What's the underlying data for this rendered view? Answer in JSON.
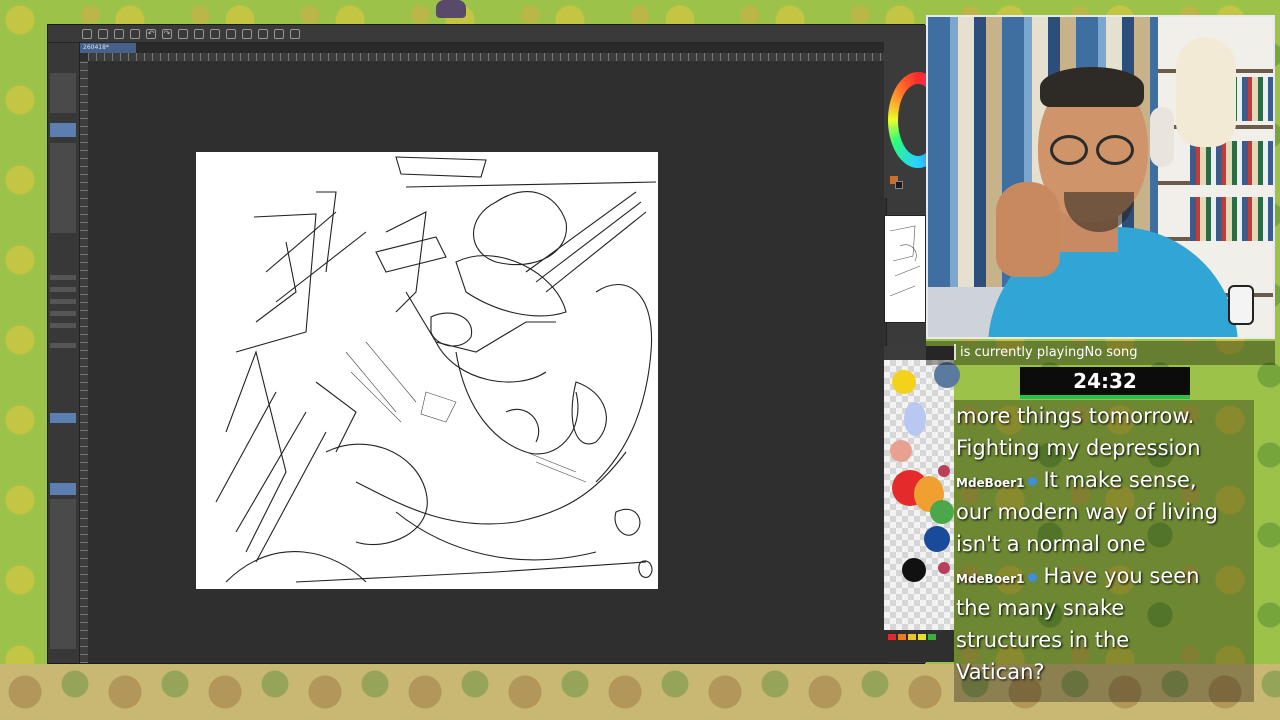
{
  "app": {
    "document_tab": "260418*",
    "toolbar_icons": [
      "new-file-icon",
      "open-icon",
      "save-icon",
      "undo-icon",
      "redo-icon",
      "transform-icon",
      "fill-icon",
      "selection-icon",
      "settings-icon"
    ]
  },
  "colors": {
    "main_color": "#c9702e",
    "sub_color": "#1a1a1a",
    "timer_accent": "#24c24a"
  },
  "stream": {
    "now_playing": "is currently playingNo song",
    "timer": "24:32"
  },
  "chat": {
    "lines": [
      {
        "text": "more things tomorrow."
      },
      {
        "text": "Fighting my depression"
      },
      {
        "user": "MdeBoer1",
        "text": "It make sense,"
      },
      {
        "text": "our modern way of living"
      },
      {
        "text": "isn't a normal one"
      },
      {
        "user": "MdeBoer1",
        "text": "Have you seen"
      },
      {
        "text": "the many snake"
      },
      {
        "text": "structures in the"
      },
      {
        "text": "Vatican?"
      }
    ]
  },
  "palette_colors": [
    "#f2d21a",
    "#5a7aa0",
    "#b8c8f0",
    "#e8a090",
    "#e42a2a",
    "#f0a030",
    "#4aa84a",
    "#1a4a9a",
    "#111111"
  ]
}
